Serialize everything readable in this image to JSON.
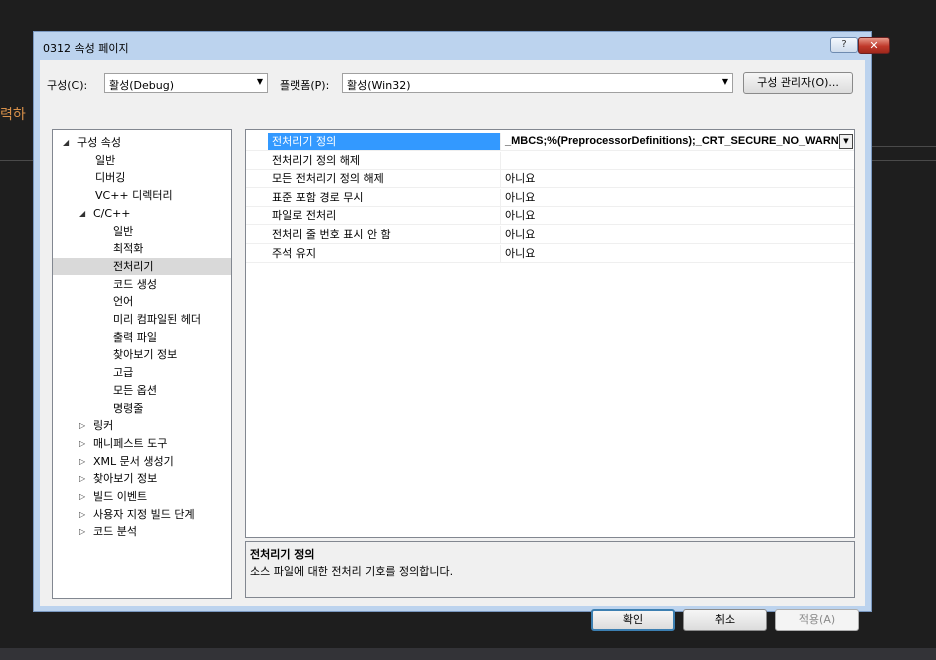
{
  "background": {
    "left_text": "력하"
  },
  "dialog": {
    "title": "0312 속성 페이지",
    "help_label": "?",
    "close_label": "✕"
  },
  "config": {
    "config_label": "구성(C):",
    "config_value": "활성(Debug)",
    "platform_label": "플랫폼(P):",
    "platform_value": "활성(Win32)",
    "manager_button": "구성 관리자(O)..."
  },
  "tree": {
    "items": [
      {
        "label": "구성 속성",
        "expander": "◢"
      },
      {
        "label": "일반"
      },
      {
        "label": "디버깅"
      },
      {
        "label": "VC++ 디렉터리"
      },
      {
        "label": "C/C++",
        "expander": "◢"
      },
      {
        "label": "일반"
      },
      {
        "label": "최적화"
      },
      {
        "label": "전처리기",
        "selected": true
      },
      {
        "label": "코드 생성"
      },
      {
        "label": "언어"
      },
      {
        "label": "미리 컴파일된 헤더"
      },
      {
        "label": "출력 파일"
      },
      {
        "label": "찾아보기 정보"
      },
      {
        "label": "고급"
      },
      {
        "label": "모든 옵션"
      },
      {
        "label": "명령줄"
      },
      {
        "label": "링커",
        "expander": "▷"
      },
      {
        "label": "매니페스트 도구",
        "expander": "▷"
      },
      {
        "label": "XML 문서 생성기",
        "expander": "▷"
      },
      {
        "label": "찾아보기 정보",
        "expander": "▷"
      },
      {
        "label": "빌드 이벤트",
        "expander": "▷"
      },
      {
        "label": "사용자 지정 빌드 단계",
        "expander": "▷"
      },
      {
        "label": "코드 분석",
        "expander": "▷"
      }
    ]
  },
  "properties": [
    {
      "name": "전처리기 정의",
      "value": "_MBCS;%(PreprocessorDefinitions);_CRT_SECURE_NO_WARN",
      "selected": true
    },
    {
      "name": "전처리기 정의 해제",
      "value": ""
    },
    {
      "name": "모든 전처리기 정의 해제",
      "value": "아니요"
    },
    {
      "name": "표준 포함 경로 무시",
      "value": "아니요"
    },
    {
      "name": "파일로 전처리",
      "value": "아니요"
    },
    {
      "name": "전처리 줄 번호 표시 안 함",
      "value": "아니요"
    },
    {
      "name": "주석 유지",
      "value": "아니요"
    }
  ],
  "description": {
    "title": "전처리기 정의",
    "text": "소스 파일에 대한 전처리 기호를 정의합니다."
  },
  "buttons": {
    "ok": "확인",
    "cancel": "취소",
    "apply": "적용(A)"
  }
}
